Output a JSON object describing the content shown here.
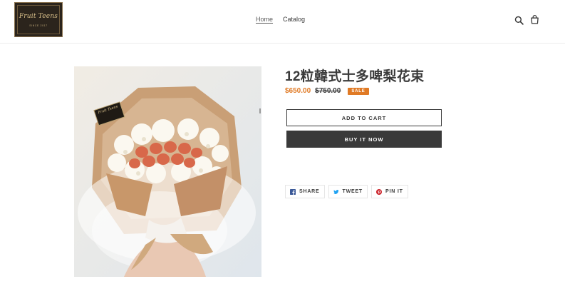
{
  "header": {
    "logo_script": "Fruit Teens",
    "logo_since": "SINCE 2017",
    "nav": [
      "Home",
      "Catalog"
    ]
  },
  "product": {
    "image_card_text": "Fruit Teens",
    "title": "12粒韓式士多啤梨花束",
    "price": "$650.00",
    "compare_price": "$750.00",
    "sale_badge": "SALE",
    "add_to_cart": "ADD TO CART",
    "buy_it_now": "BUY IT NOW"
  },
  "share": {
    "facebook": "SHARE",
    "twitter": "TWEET",
    "pinterest": "PIN IT"
  },
  "colors": {
    "accent": "#e07a25",
    "text": "#3a3a3a",
    "logo_bg": "#2b241c",
    "logo_gold": "#d9c08a",
    "facebook": "#3b5998",
    "twitter": "#1da1f2",
    "pinterest": "#cb2027"
  }
}
